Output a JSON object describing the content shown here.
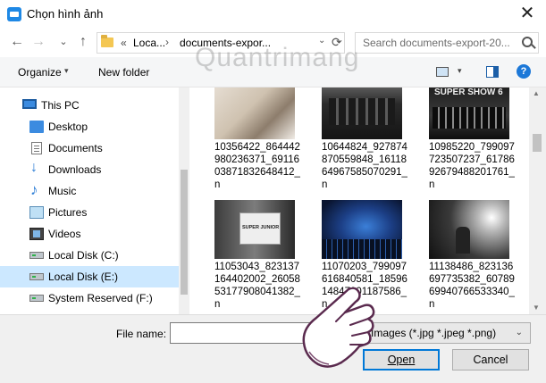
{
  "window": {
    "title": "Chọn hình ảnh",
    "close_glyph": "✕"
  },
  "nav": {
    "back_glyph": "←",
    "forward_glyph": "→",
    "dropdown_glyph": "⌄",
    "up_glyph": "↑",
    "breadcrumb_prefix": "«",
    "breadcrumb": [
      "Loca...",
      "documents-expor..."
    ],
    "breadcrumb_separator": "›",
    "address_dropdown_glyph": "⌄",
    "refresh_glyph": "⟳",
    "search_placeholder": "Search documents-export-20..."
  },
  "toolbar": {
    "organize_label": "Organize",
    "organize_arrow": "▾",
    "new_folder_label": "New folder",
    "view_arrow": "▾",
    "help_glyph": "?"
  },
  "watermark": "Quantrimang",
  "sidebar": {
    "items": [
      {
        "label": "This PC",
        "icon": "computer-icon"
      },
      {
        "label": "Desktop",
        "icon": "desktop-icon"
      },
      {
        "label": "Documents",
        "icon": "documents-icon"
      },
      {
        "label": "Downloads",
        "icon": "downloads-icon"
      },
      {
        "label": "Music",
        "icon": "music-icon"
      },
      {
        "label": "Pictures",
        "icon": "pictures-icon"
      },
      {
        "label": "Videos",
        "icon": "videos-icon"
      },
      {
        "label": "Local Disk (C:)",
        "icon": "drive-icon"
      },
      {
        "label": "Local Disk (E:)",
        "icon": "drive-icon",
        "selected": true
      },
      {
        "label": "System Reserved (F:)",
        "icon": "drive-icon"
      }
    ]
  },
  "files": [
    {
      "name": "10356422_864442980236371_6911603871832648412_n",
      "thumb_caption": ""
    },
    {
      "name": "10644824_927874870559848_1611864967585070291_n",
      "thumb_caption": ""
    },
    {
      "name": "10985220_799097723507237_6178692679488201761_n",
      "thumb_caption": "SUPER SHOW 6"
    },
    {
      "name": "11053043_823137164402002_2605853177908041382_n",
      "thumb_caption": "SUPER JUNIOR"
    },
    {
      "name": "11070203_799097616840581_1859614847801187586_n",
      "thumb_caption": ""
    },
    {
      "name": "11138486_823136697735382_6078969940766533340_n",
      "thumb_caption": ""
    }
  ],
  "bottom": {
    "file_name_label": "File name:",
    "file_name_value": "",
    "filter_value": "Images (*.jpg *.jpeg *.png)",
    "filter_arrow": "⌄",
    "open_label": "Open",
    "cancel_label": "Cancel"
  },
  "colors": {
    "accent": "#0078d7",
    "selection": "#cce8ff",
    "hover": "#e5f3ff"
  }
}
